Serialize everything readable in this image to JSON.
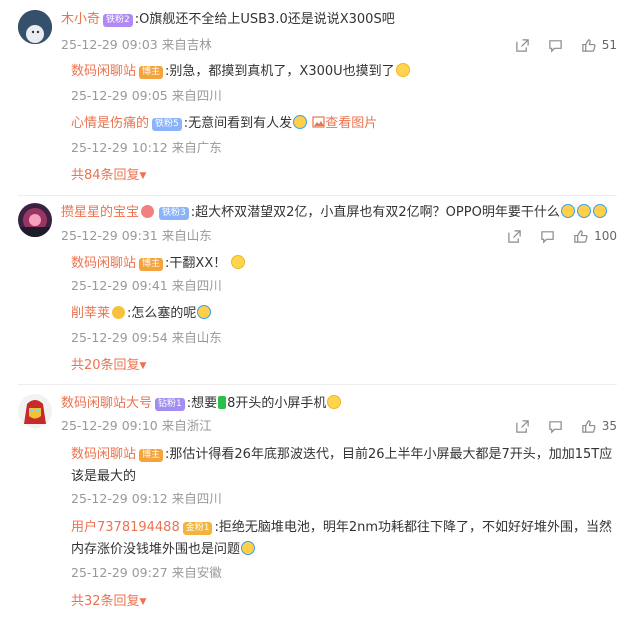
{
  "comments": [
    {
      "user": "木小奇",
      "badge": "铁粉2",
      "text": ":O旗舰还不全给上USB3.0还是说说X300S吧",
      "time": "25-12-29 09:03",
      "location": "来自吉林",
      "likes": "51",
      "replies": [
        {
          "user": "数码闲聊站",
          "badge": "博主",
          "text": ":别急，都摸到真机了，X300U也摸到了",
          "time": "25-12-29 09:05",
          "location": "来自四川"
        },
        {
          "user": "心情是伤痛的",
          "badge": "铁粉5",
          "text": ":无意间看到有人发",
          "link": "查看图片",
          "time": "25-12-29 10:12",
          "location": "来自广东"
        }
      ],
      "more": "共84条回复"
    },
    {
      "user": "攒星星的宝宝",
      "badge": "铁粉3",
      "text": ":超大杯双潜望双2亿，小直屏也有双2亿啊？OPPO明年要干什么",
      "time": "25-12-29 09:31",
      "location": "来自山东",
      "likes": "100",
      "replies": [
        {
          "user": "数码闲聊站",
          "badge": "博主",
          "text": ":干翻XX！",
          "time": "25-12-29 09:41",
          "location": "来自四川"
        },
        {
          "user": "削莘莱",
          "badge": "",
          "text": ":怎么塞的呢",
          "time": "25-12-29 09:54",
          "location": "来自山东"
        }
      ],
      "more": "共20条回复"
    },
    {
      "user": "数码闲聊站大号",
      "badge": "钻粉1",
      "text": ":想要",
      "text_after": "8开头的小屏手机",
      "time": "25-12-29 09:10",
      "location": "来自浙江",
      "likes": "35",
      "replies": [
        {
          "user": "数码闲聊站",
          "badge": "博主",
          "text": ":那估计得看26年底那波迭代，目前26上半年小屏最大都是7开头，加加15T应该是最大的",
          "time": "25-12-29 09:12",
          "location": "来自四川"
        },
        {
          "user": "用户7378194488",
          "badge": "金粉1",
          "text": ":拒绝无脑堆电池，明年2nm功耗都往下降了，不如好好堆外围，当然内存涨价没钱堆外围也是问题",
          "time": "25-12-29 09:27",
          "location": "来自安徽"
        }
      ],
      "more": "共32条回复"
    }
  ],
  "icons": [
    "share-icon",
    "comment-icon",
    "like-icon",
    "chevron-down-icon",
    "image-icon"
  ],
  "colors": {
    "name": "#eb7350",
    "meta": "#999999",
    "text": "#333333"
  }
}
